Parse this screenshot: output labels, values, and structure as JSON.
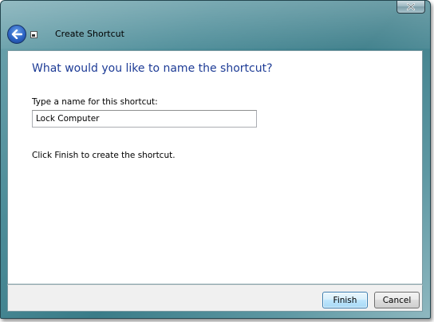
{
  "window": {
    "title": "Create Shortcut",
    "close_label": "Close"
  },
  "page": {
    "heading": "What would you like to name the shortcut?",
    "field_label": "Type a name for this shortcut:",
    "name_value": "Lock Computer",
    "instruction": "Click Finish to create the shortcut."
  },
  "buttons": {
    "finish": "Finish",
    "cancel": "Cancel"
  },
  "icons": {
    "back": "back-arrow-icon",
    "wizard": "shortcut-wizard-icon",
    "close": "close-x-icon"
  },
  "colors": {
    "heading": "#1e3c96",
    "frame": "#4c8c98",
    "back_button": "#2c64c4"
  }
}
